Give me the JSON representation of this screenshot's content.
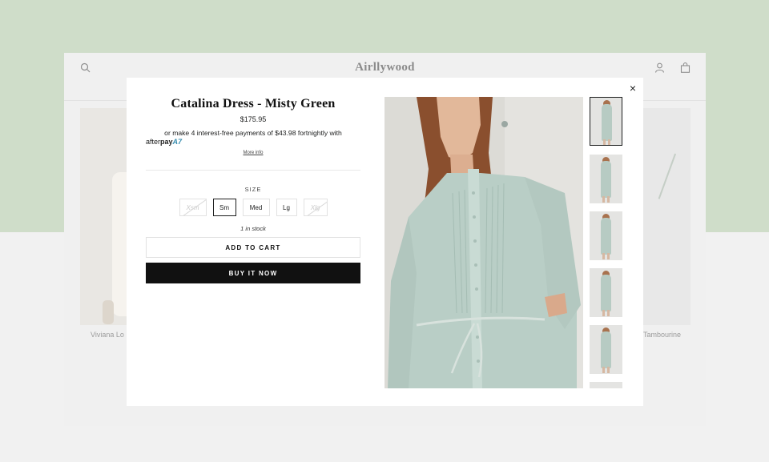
{
  "store": {
    "logo": "Airllywood",
    "tile_left_caption": "Viviana Lo",
    "tile_right_caption": "Tambourine"
  },
  "modal": {
    "close_label": "×",
    "product_title": "Catalina Dress - Misty Green",
    "price": "$175.95",
    "installments_text": "or make 4 interest-free payments of $43.98 fortnightly with",
    "afterpay_word": "after",
    "afterpay_pay": "pay",
    "afterpay_mark": "A7",
    "more_info": "More info",
    "size_label": "SIZE",
    "sizes": [
      {
        "label": "Xsm",
        "state": "unavailable"
      },
      {
        "label": "Sm",
        "state": "selected"
      },
      {
        "label": "Med",
        "state": "available"
      },
      {
        "label": "Lg",
        "state": "available"
      },
      {
        "label": "Xlg",
        "state": "unavailable"
      }
    ],
    "stock_text": "1 in stock",
    "add_to_cart": "ADD TO CART",
    "buy_now": "BUY IT NOW",
    "thumbnail_count_visible": 6
  },
  "colors": {
    "background_top": "#cfddc9",
    "background_bottom": "#f1f1f1",
    "dress": "#b9cec6",
    "buy_button": "#111111",
    "afterpay_mark": "#3b8fb0"
  },
  "icons": {
    "search": "search-icon",
    "account": "account-icon",
    "cart": "cart-icon",
    "close": "close-icon"
  }
}
